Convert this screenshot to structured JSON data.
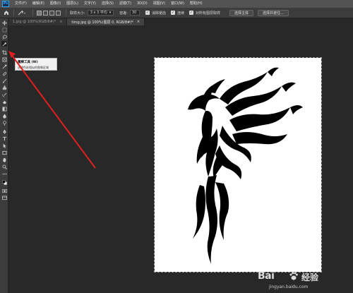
{
  "app": {
    "logo_text": "Ps"
  },
  "menu": [
    {
      "label": "文件(F)"
    },
    {
      "label": "编辑(E)"
    },
    {
      "label": "图像(I)"
    },
    {
      "label": "图层(L)"
    },
    {
      "label": "文字(Y)"
    },
    {
      "label": "选择(S)"
    },
    {
      "label": "滤镜(T)"
    },
    {
      "label": "3D(D)"
    },
    {
      "label": "视图(V)"
    },
    {
      "label": "窗口(W)"
    },
    {
      "label": "帮助(H)"
    }
  ],
  "options": {
    "sample_size_label": "取样大小:",
    "sample_size_value": "3 x 3 平均",
    "tolerance_label": "容差:",
    "tolerance_value": "30",
    "antialias_label": "消除锯齿",
    "contiguous_label": "连续",
    "sample_all_label": "对所有图层取样",
    "select_subject_label": "选择主体",
    "select_mask_label": "选择并遮住..."
  },
  "tabs": [
    {
      "label": "1.jpg @ 100%(RGB/8#)*",
      "close": "×"
    },
    {
      "label": "timg.jpg @ 100%(图层 0, RGB/8#)*",
      "close": "×"
    }
  ],
  "tooltip": {
    "title": "魔棒工具 (W)",
    "description": "选择色彩相似的图像区域"
  },
  "watermark": {
    "brand": "Bai",
    "brand_cn": "经验",
    "url": "jingyan.baidu.com"
  },
  "colors": {
    "accent": "#31a8ff",
    "arrow": "#e02020",
    "canvas": "#ffffff",
    "workspace": "#282828"
  }
}
